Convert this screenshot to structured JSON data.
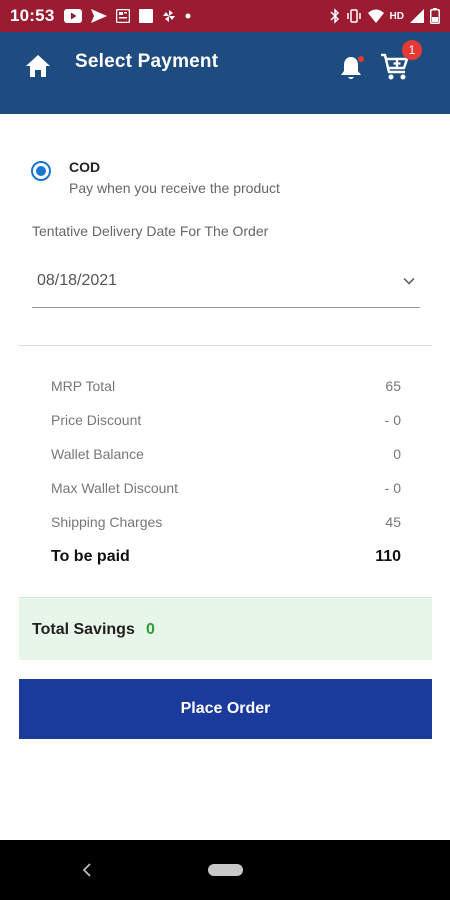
{
  "status_bar": {
    "time": "10:53",
    "network_label": "HD",
    "colors": {
      "background": "#9b1b30"
    }
  },
  "app_bar": {
    "title": "Select Payment",
    "cart_count": "1",
    "colors": {
      "background": "#1e4c80",
      "badge": "#e53935"
    }
  },
  "payment": {
    "option_title": "COD",
    "option_subtitle": "Pay when you receive the product",
    "selected": true,
    "delivery_label": "Tentative Delivery Date For The Order",
    "delivery_date": "08/18/2021"
  },
  "summary": {
    "rows": [
      {
        "label": "MRP Total",
        "value": "65"
      },
      {
        "label": "Price Discount",
        "value": "- 0"
      },
      {
        "label": "Wallet Balance",
        "value": "0"
      },
      {
        "label": "Max Wallet Discount",
        "value": "- 0"
      },
      {
        "label": "Shipping Charges",
        "value": "45"
      }
    ],
    "total_label": "To be paid",
    "total_value": "110"
  },
  "savings": {
    "label": "Total Savings",
    "value": "0",
    "colors": {
      "background": "#e8f5e9",
      "value": "#2e9e3a"
    }
  },
  "actions": {
    "place_order_label": "Place Order",
    "colors": {
      "button": "#1a3a9c"
    }
  }
}
